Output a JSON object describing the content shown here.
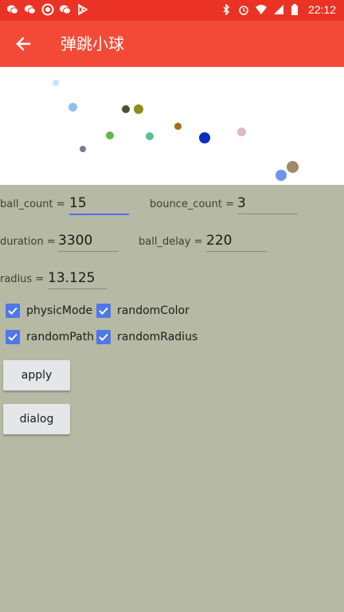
{
  "status_bar": {
    "time": "22:12",
    "left_icons": [
      "wechat-icon",
      "wechat-icon",
      "circle-icon",
      "wechat-icon",
      "play-store-icon"
    ],
    "right_icons": [
      "bluetooth-icon",
      "alarm-icon",
      "wifi-icon",
      "signal-icon",
      "battery-icon"
    ]
  },
  "app_bar": {
    "title": "弹跳小球",
    "back_icon": "arrow-back-icon",
    "color": "#f34a38"
  },
  "canvas": {
    "background": "#ffffff",
    "balls": [
      {
        "color": "#cbe3ff"
      },
      {
        "color": "#8fbff0"
      },
      {
        "color": "#4f4f2a"
      },
      {
        "color": "#8f8f18"
      },
      {
        "color": "#a06d1b"
      },
      {
        "color": "#e0b6c9"
      },
      {
        "color": "#5fb749"
      },
      {
        "color": "#53c48f"
      },
      {
        "color": "#0b2bc3"
      },
      {
        "color": "#767a95"
      },
      {
        "color": "#6d95ef"
      },
      {
        "color": "#9e8a6a"
      }
    ]
  },
  "form": {
    "ball_count": {
      "label": "ball_count =",
      "value": "15"
    },
    "bounce_count": {
      "label": "bounce_count =",
      "value": "3"
    },
    "duration": {
      "label": "duration =",
      "value": "3300"
    },
    "ball_delay": {
      "label": "ball_delay =",
      "value": "220"
    },
    "radius": {
      "label": "radius =",
      "value": "13.125"
    }
  },
  "checkboxes": [
    {
      "label": "physicMode",
      "checked": true
    },
    {
      "label": "randomColor",
      "checked": true
    },
    {
      "label": "randomPath",
      "checked": true
    },
    {
      "label": "randomRadius",
      "checked": true
    }
  ],
  "buttons": {
    "apply": "apply",
    "dialog": "dialog"
  },
  "colors": {
    "accent": "#4f77e8",
    "background": "#b6b9a3"
  }
}
